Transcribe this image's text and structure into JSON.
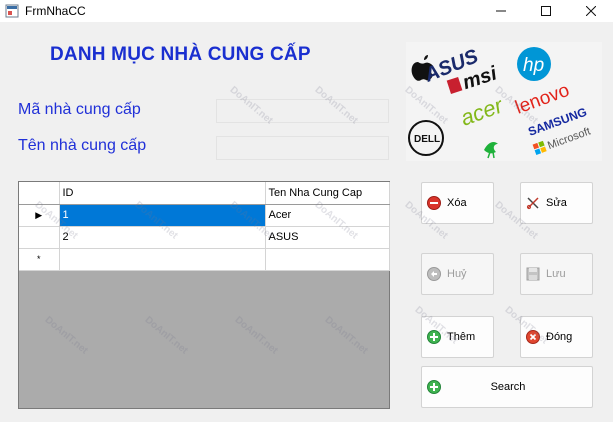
{
  "window": {
    "title": "FrmNhaCC",
    "minimize": "—",
    "maximize": "☐",
    "close": "✕"
  },
  "heading": "DANH MỤC NHÀ CUNG CẤP",
  "form": {
    "ma_label": "Mã nhà cung cấp",
    "ma_value": "",
    "ten_label": "Tên nhà cung cấp",
    "ten_value": ""
  },
  "logos": [
    "ASUS",
    "msi",
    "hp",
    "acer",
    "lenovo",
    "SAMSUNG",
    "Microsoft",
    "DELL"
  ],
  "grid": {
    "columns": [
      "ID",
      "Ten Nha Cung Cap"
    ],
    "rows": [
      {
        "id": "1",
        "name": "Acer",
        "selected": true
      },
      {
        "id": "2",
        "name": "ASUS",
        "selected": false
      }
    ],
    "current_row_marker": "▶",
    "new_row_marker": "*"
  },
  "buttons": {
    "xoa": "Xóa",
    "sua": "Sửa",
    "huy": "Huỷ",
    "luu": "Lưu",
    "them": "Thêm",
    "dong": "Đóng",
    "search": "Search"
  },
  "watermark": "DoAnIT.net",
  "colors": {
    "heading": "#1a2fd0",
    "label": "#2030d8",
    "selection": "#0078d7",
    "grid_bg": "#ababab"
  }
}
